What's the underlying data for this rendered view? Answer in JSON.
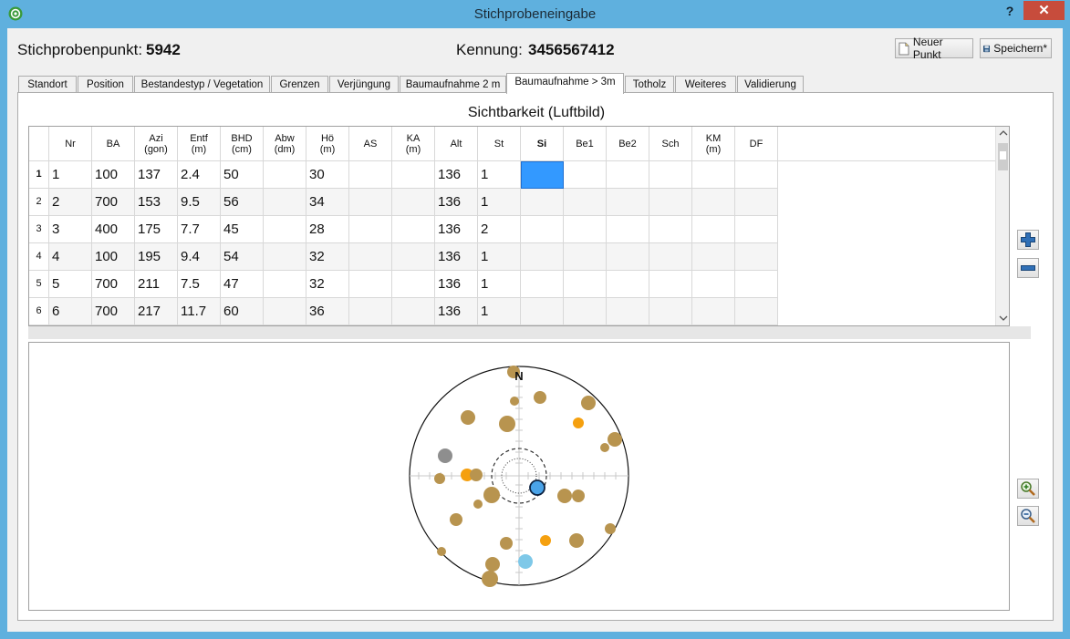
{
  "window": {
    "title": "Stichprobeneingabe",
    "help": "?",
    "close": "✕"
  },
  "header": {
    "punkt_label": "Stichprobenpunkt:",
    "punkt_value": "5942",
    "kennung_label": "Kennung:",
    "kennung_value": "3456567412",
    "new_point_label": "Neuer Punkt",
    "save_label": "Speichern*"
  },
  "tabs": [
    {
      "label": "Standort"
    },
    {
      "label": "Position"
    },
    {
      "label": "Bestandestyp / Vegetation"
    },
    {
      "label": "Grenzen"
    },
    {
      "label": "Verjüngung"
    },
    {
      "label": "Baumaufnahme 2 m"
    },
    {
      "label": "Baumaufnahme > 3m"
    },
    {
      "label": "Totholz"
    },
    {
      "label": "Weiteres"
    },
    {
      "label": "Validierung"
    }
  ],
  "active_tab": "Baumaufnahme > 3m",
  "section_title": "Sichtbarkeit (Luftbild)",
  "table": {
    "columns": [
      {
        "l1": "Nr",
        "l2": ""
      },
      {
        "l1": "BA",
        "l2": ""
      },
      {
        "l1": "Azi",
        "l2": "(gon)"
      },
      {
        "l1": "Entf",
        "l2": "(m)"
      },
      {
        "l1": "BHD",
        "l2": "(cm)"
      },
      {
        "l1": "Abw",
        "l2": "(dm)"
      },
      {
        "l1": "Hö",
        "l2": "(m)"
      },
      {
        "l1": "AS",
        "l2": ""
      },
      {
        "l1": "KA",
        "l2": "(m)"
      },
      {
        "l1": "Alt",
        "l2": ""
      },
      {
        "l1": "St",
        "l2": ""
      },
      {
        "l1": "Si",
        "l2": ""
      },
      {
        "l1": "Be1",
        "l2": ""
      },
      {
        "l1": "Be2",
        "l2": ""
      },
      {
        "l1": "Sch",
        "l2": ""
      },
      {
        "l1": "KM",
        "l2": "(m)"
      },
      {
        "l1": "DF",
        "l2": ""
      }
    ],
    "rows": [
      {
        "rh": "1",
        "cells": [
          "1",
          "100",
          "137",
          "2.4",
          "50",
          "",
          "30",
          "",
          "",
          "136",
          "1",
          "",
          "",
          "",
          "",
          "",
          ""
        ]
      },
      {
        "rh": "2",
        "cells": [
          "2",
          "700",
          "153",
          "9.5",
          "56",
          "",
          "34",
          "",
          "",
          "136",
          "1",
          "",
          "",
          "",
          "",
          "",
          ""
        ]
      },
      {
        "rh": "3",
        "cells": [
          "3",
          "400",
          "175",
          "7.7",
          "45",
          "",
          "28",
          "",
          "",
          "136",
          "2",
          "",
          "",
          "",
          "",
          "",
          ""
        ]
      },
      {
        "rh": "4",
        "cells": [
          "4",
          "100",
          "195",
          "9.4",
          "54",
          "",
          "32",
          "",
          "",
          "136",
          "1",
          "",
          "",
          "",
          "",
          "",
          ""
        ]
      },
      {
        "rh": "5",
        "cells": [
          "5",
          "700",
          "211",
          "7.5",
          "47",
          "",
          "32",
          "",
          "",
          "136",
          "1",
          "",
          "",
          "",
          "",
          "",
          ""
        ]
      },
      {
        "rh": "6",
        "cells": [
          "6",
          "700",
          "217",
          "11.7",
          "60",
          "",
          "36",
          "",
          "",
          "136",
          "1",
          "",
          "",
          "",
          "",
          "",
          ""
        ]
      }
    ],
    "selected_cell": {
      "row": 0,
      "column": "Si"
    },
    "selection_color": "#3399ff"
  },
  "plot": {
    "north_label": "N",
    "colors": {
      "tree": "#b8944f",
      "highlight": "#f5a00f",
      "grey": "#8e8e8e",
      "lightblue": "#7ec8e8",
      "selected": "#4aa3e8"
    },
    "side_icons": [
      "zoom-in-icon",
      "zoom-out-icon"
    ]
  }
}
